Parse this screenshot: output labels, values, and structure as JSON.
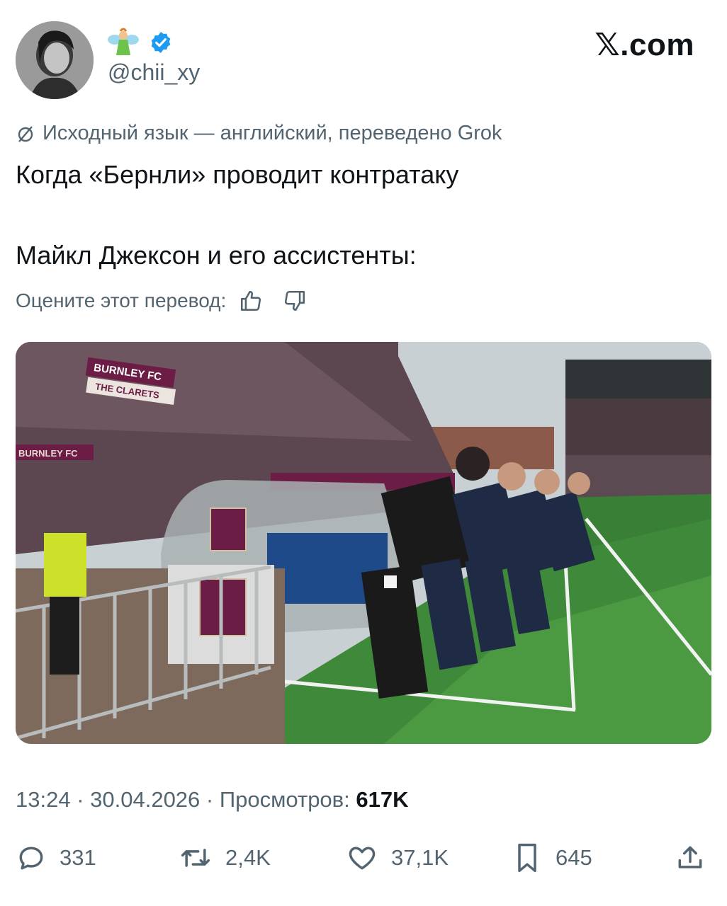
{
  "author": {
    "handle": "@chii_xy",
    "emoji_icon": "fairy-emoji-icon",
    "verified_icon": "verified-badge-icon",
    "verified_color": "#1d9bf0"
  },
  "brand": {
    "logo_text": "𝕏.com"
  },
  "translation": {
    "note": "Исходный язык — английский, переведено Grok",
    "rate_label": "Оцените этот перевод:"
  },
  "tweet": {
    "line1": "Когда «Бернли» проводит контратаку",
    "line2": "Майкл Джексон и его ассистенты:"
  },
  "media": {
    "signs": [
      "BURNLEY FC",
      "THE CLARETS",
      "BURNLEY FC"
    ]
  },
  "meta": {
    "time": "13:24",
    "date": "30.04.2026",
    "views_label": "Просмотров:",
    "views_value": "617K"
  },
  "actions": {
    "replies": "331",
    "reposts": "2,4K",
    "likes": "37,1K",
    "bookmarks": "645"
  },
  "colors": {
    "muted": "#536471",
    "text": "#0f1419",
    "claret": "#6c1d45",
    "pitch": "#3f8a3a"
  }
}
